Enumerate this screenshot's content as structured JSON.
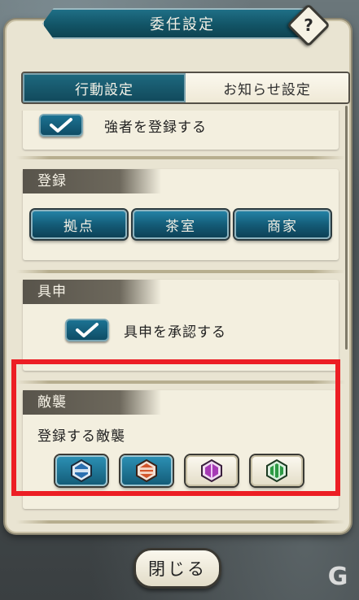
{
  "dialog": {
    "title": "委任設定",
    "help_label": "?"
  },
  "tabs": [
    {
      "label": "行動設定",
      "active": true
    },
    {
      "label": "お知らせ設定",
      "active": false
    }
  ],
  "sections": {
    "top": {
      "checkbox_checked": true,
      "label": "強者を登録する"
    },
    "register": {
      "heading": "登録",
      "buttons": [
        "拠点",
        "茶室",
        "商家"
      ]
    },
    "report": {
      "heading": "具申",
      "checkbox_checked": true,
      "label": "具申を承認する"
    },
    "enemy": {
      "heading": "敵襲",
      "label": "登録する敵襲",
      "options": [
        {
          "icon": "blue-hexagon-icon",
          "color": "#2a6fb0",
          "selected": true
        },
        {
          "icon": "orange-hexagon-icon",
          "color": "#d2552a",
          "selected": true
        },
        {
          "icon": "purple-hexagon-icon",
          "color": "#a63ab5",
          "selected": false
        },
        {
          "icon": "green-hexagon-icon",
          "color": "#2d9a45",
          "selected": false
        }
      ]
    }
  },
  "footer": {
    "close_label": "閉じる"
  },
  "highlight_color": "#ec1e24"
}
